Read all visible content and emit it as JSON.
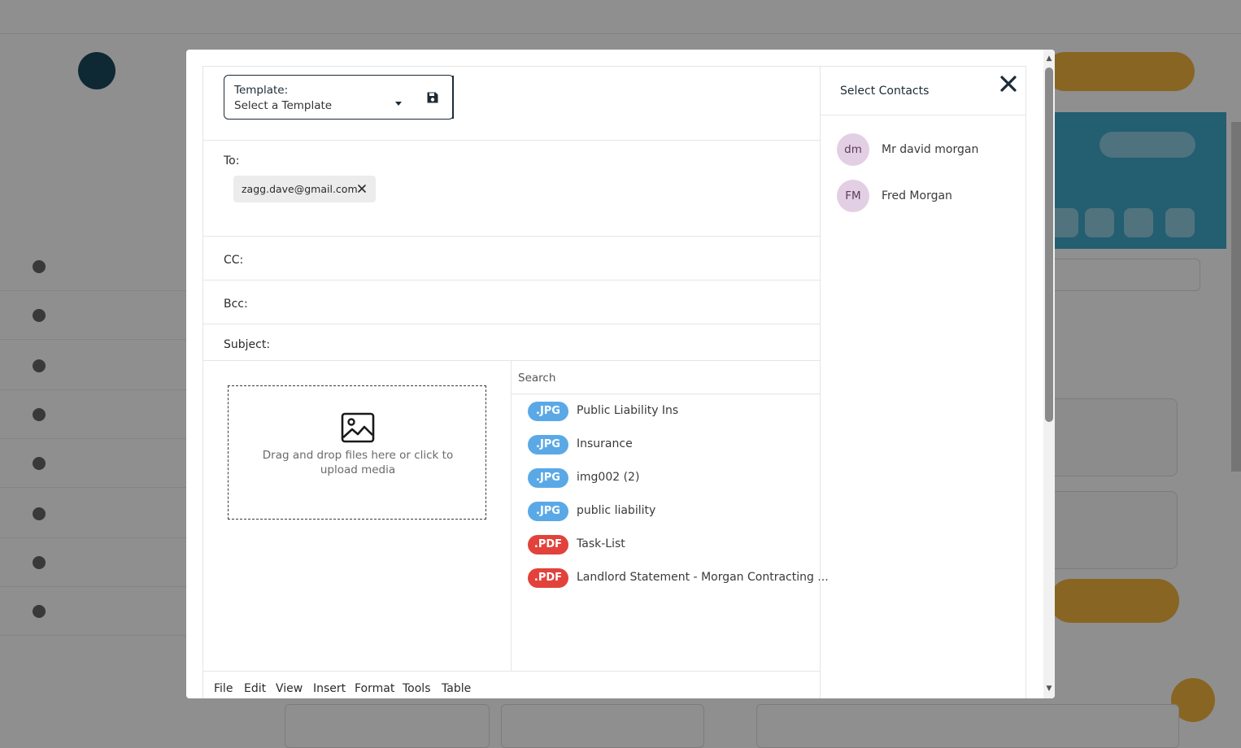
{
  "colors": {
    "accent_dark": "#1d2b36",
    "jpg_badge": "#5aa9e6",
    "pdf_badge": "#e2423b",
    "avatar_bg": "#e3cfe3",
    "chip_bg": "#ececec"
  },
  "template": {
    "label": "Template:",
    "value": "Select a Template",
    "save_icon": "floppy-disk-icon"
  },
  "fields": {
    "to_label": "To:",
    "cc_label": "CC:",
    "bcc_label": "Bcc:",
    "subject_label": "Subject:"
  },
  "recipients": [
    {
      "email": "zagg.dave@gmail.com"
    }
  ],
  "upload": {
    "text": "Drag and drop files here or click to upload media",
    "icon": "image-icon"
  },
  "files": {
    "search_placeholder": "Search",
    "items": [
      {
        "type": ".JPG",
        "name": "Public Liability Ins"
      },
      {
        "type": ".JPG",
        "name": "Insurance"
      },
      {
        "type": ".JPG",
        "name": "img002 (2)"
      },
      {
        "type": ".JPG",
        "name": "public liability"
      },
      {
        "type": ".PDF",
        "name": "Task-List"
      },
      {
        "type": ".PDF",
        "name": "Landlord Statement - Morgan Contracting ..."
      }
    ]
  },
  "editor_menu": [
    "File",
    "Edit",
    "View",
    "Insert",
    "Format",
    "Tools",
    "Table"
  ],
  "contacts": {
    "title": "Select Contacts",
    "items": [
      {
        "initials": "dm",
        "name": "Mr david morgan"
      },
      {
        "initials": "FM",
        "name": "Fred Morgan"
      }
    ]
  }
}
